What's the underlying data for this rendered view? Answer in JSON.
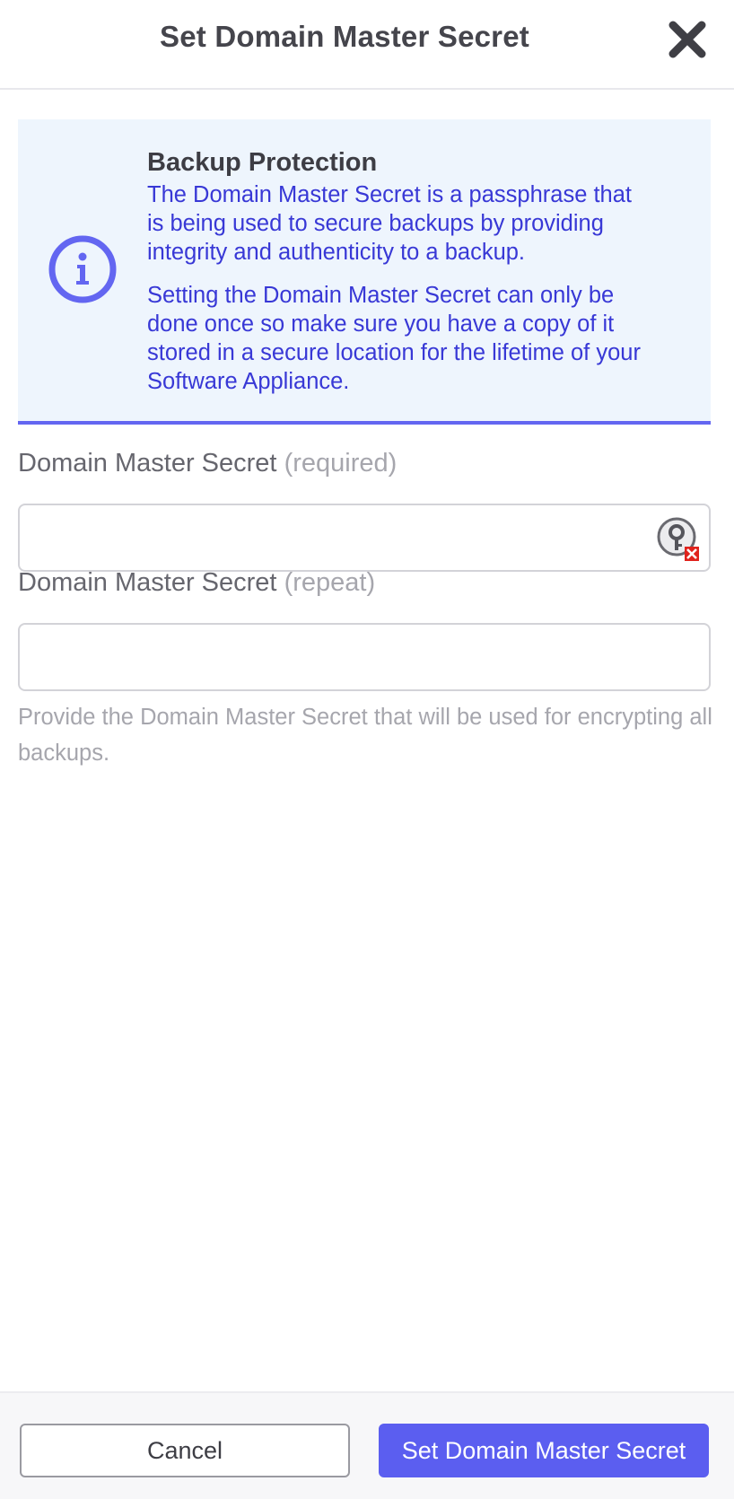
{
  "dialog": {
    "title": "Set Domain Master Secret",
    "close_icon": "close-icon"
  },
  "callout": {
    "icon": "info-icon",
    "title": "Backup Protection",
    "paragraph_1": "The Domain Master Secret is a passphrase that is being used to secure backups by providing integrity and authenticity to a backup.",
    "paragraph_2": "Setting the Domain Master Secret can only be done once so make sure you have a copy of it stored in a secure location for the lifetime of your Software Appliance.",
    "accent_color": "#6366f1",
    "text_color": "#3838d6",
    "background": "#eef5fd"
  },
  "form": {
    "secret": {
      "label": "Domain Master Secret",
      "hint": "(required)",
      "value": "",
      "placeholder": "",
      "addon_icon": "password-manager-key-icon"
    },
    "secret_repeat": {
      "label": "Domain Master Secret",
      "hint": "(repeat)",
      "value": "",
      "placeholder": ""
    },
    "help_text": "Provide the Domain Master Secret that will be used for encrypting all backups."
  },
  "footer": {
    "cancel_label": "Cancel",
    "submit_label": "Set Domain Master Secret",
    "primary_color": "#5b5ef0"
  }
}
